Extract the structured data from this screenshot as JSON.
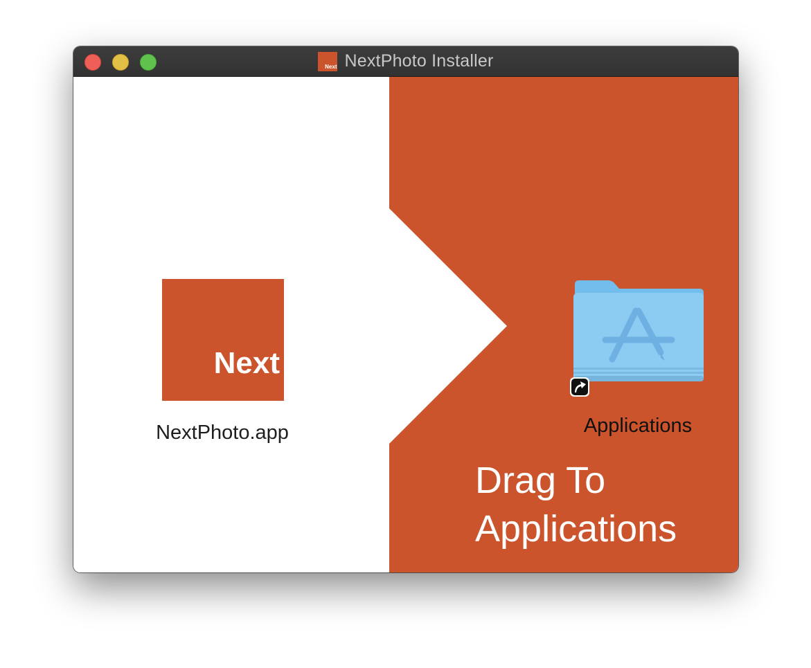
{
  "window": {
    "title": "NextPhoto Installer",
    "title_icon_text": "Next"
  },
  "app": {
    "icon_text": "Next",
    "label": "NextPhoto.app"
  },
  "target": {
    "label": "Applications"
  },
  "instruction": {
    "line1": "Drag To",
    "line2": "Applications"
  },
  "colors": {
    "brand": "#cb542c",
    "folder": "#8ccbf2"
  },
  "icons": {
    "app": "nextphoto-app-icon",
    "folder": "applications-folder-icon",
    "alias": "alias-arrow-icon"
  }
}
